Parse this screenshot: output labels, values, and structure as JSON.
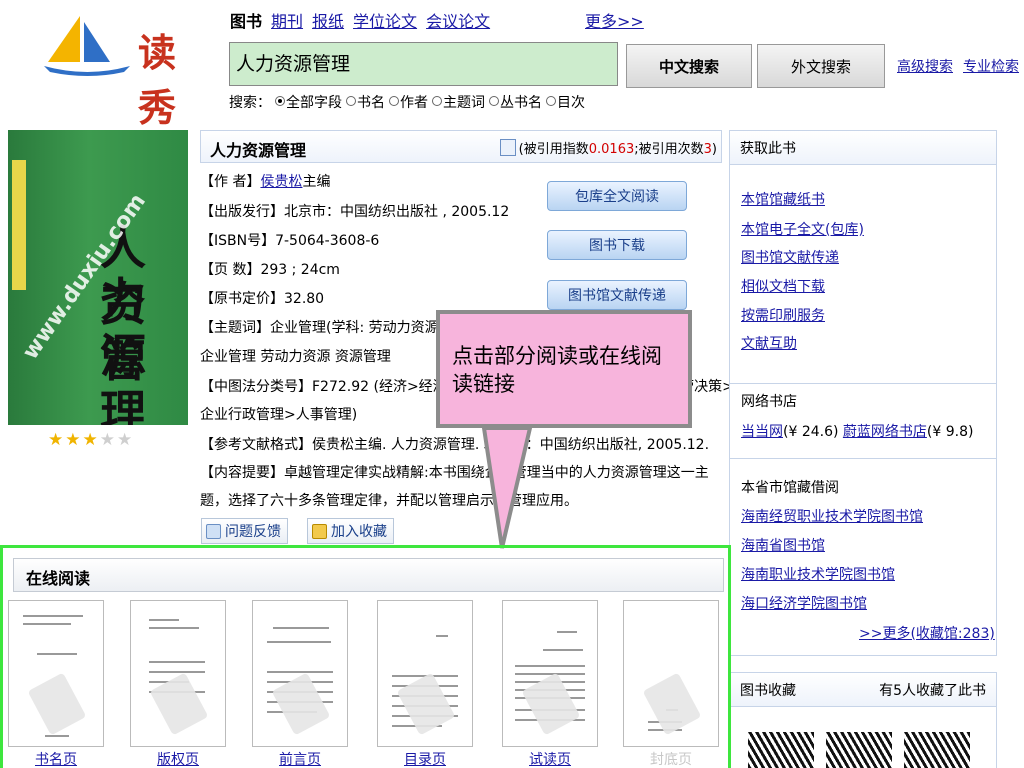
{
  "header": {
    "logo_text": "读秀",
    "categories": [
      {
        "label": "图书",
        "active": true
      },
      {
        "label": "期刊",
        "active": false
      },
      {
        "label": "报纸",
        "active": false
      },
      {
        "label": "学位论文",
        "active": false
      },
      {
        "label": "会议论文",
        "active": false
      }
    ],
    "more": "更多>>",
    "search_value": "人力资源管理",
    "btn_chinese": "中文搜索",
    "btn_foreign": "外文搜索",
    "advanced": "高级搜索",
    "professional": "专业检索",
    "search_label": "搜索：",
    "scopes": [
      {
        "label": "全部字段",
        "selected": true
      },
      {
        "label": "书名",
        "selected": false
      },
      {
        "label": "作者",
        "selected": false
      },
      {
        "label": "主题词",
        "selected": false
      },
      {
        "label": "丛书名",
        "selected": false
      },
      {
        "label": "目次",
        "selected": false
      }
    ]
  },
  "cover": {
    "big_text": [
      "人力",
      "资源",
      "管理"
    ],
    "watermark": "www.duxiu.com",
    "rating": 3,
    "rating_max": 5
  },
  "book": {
    "title": "人力资源管理",
    "cite_prefix": "(被引用指数",
    "cite_index": "0.0163",
    "cite_mid": ";被引用次数",
    "cite_count": "3",
    "cite_suffix": ")",
    "author_label": "【作 者】",
    "author": "侯贵松",
    "author_suffix": "主编",
    "publisher": "【出版发行】北京市：中国纺织出版社 , 2005.12",
    "isbn": "【ISBN号】7-5064-3608-6",
    "pages": "【页 数】293 ; 24cm",
    "price": "【原书定价】32.80",
    "subject": "【主题词】企业管理(学科: 劳动力资源 学科: 资源管理)",
    "subject_cont": "企业管理 劳动力资源 资源管理",
    "clc": "【中图法分类号】F272.92 (经济>经济计划与管理>企业经济>企业计划与经营决策>",
    "clc_cont": "企业行政管理>人事管理)",
    "ref_format": "【参考文献格式】侯贵松主编. 人力资源管理. 北京市：中国纺织出版社, 2005.12.",
    "summary": "【内容提要】卓越管理定律实战精解:本书围绕企业管理当中的人力资源管理这一主",
    "summary_cont": "题，选择了六十多条管理定律，并配以管理启示和管理应用。",
    "btn_fulltext": "包库全文阅读",
    "btn_download": "图书下载",
    "btn_delivery": "图书馆文献传递",
    "feedback": "问题反馈",
    "favorite": "加入收藏"
  },
  "callout": {
    "text": "点击部分阅读或在线阅读链接"
  },
  "sidebar": {
    "get_title": "获取此书",
    "get_links": [
      "本馆馆藏纸书",
      "本馆电子全文(包库)",
      "图书馆文献传递",
      "相似文档下载",
      "按需印刷服务",
      "文献互助"
    ],
    "shops_title": "网络书店",
    "shop1": "当当网",
    "shop1_price": "(¥ 24.6)",
    "shop2": "蔚蓝网络书店",
    "shop2_price": "(¥ 9.8)",
    "libs_title": "本省市馆藏借阅",
    "libs": [
      "海南经贸职业技术学院图书馆",
      "海南省图书馆",
      "海南职业技术学院图书馆",
      "海口经济学院图书馆"
    ],
    "libs_more": ">>更多(收藏馆:283)",
    "collect_title": "图书收藏",
    "collect_count": "有5人收藏了此书"
  },
  "online": {
    "title": "在线阅读",
    "pages": [
      {
        "label": "书名页",
        "faded": false
      },
      {
        "label": "版权页",
        "faded": false
      },
      {
        "label": "前言页",
        "faded": false
      },
      {
        "label": "目录页",
        "faded": false
      },
      {
        "label": "试读页",
        "faded": false
      },
      {
        "label": "封底页",
        "faded": true
      }
    ]
  },
  "colors": {
    "link": "#1a1aa6",
    "search_bg": "#cdeccd",
    "highlight_border": "#3ee63e",
    "callout_bg": "#f7b4dc",
    "cite_red": "#d20000",
    "star_on": "#f0b400"
  }
}
